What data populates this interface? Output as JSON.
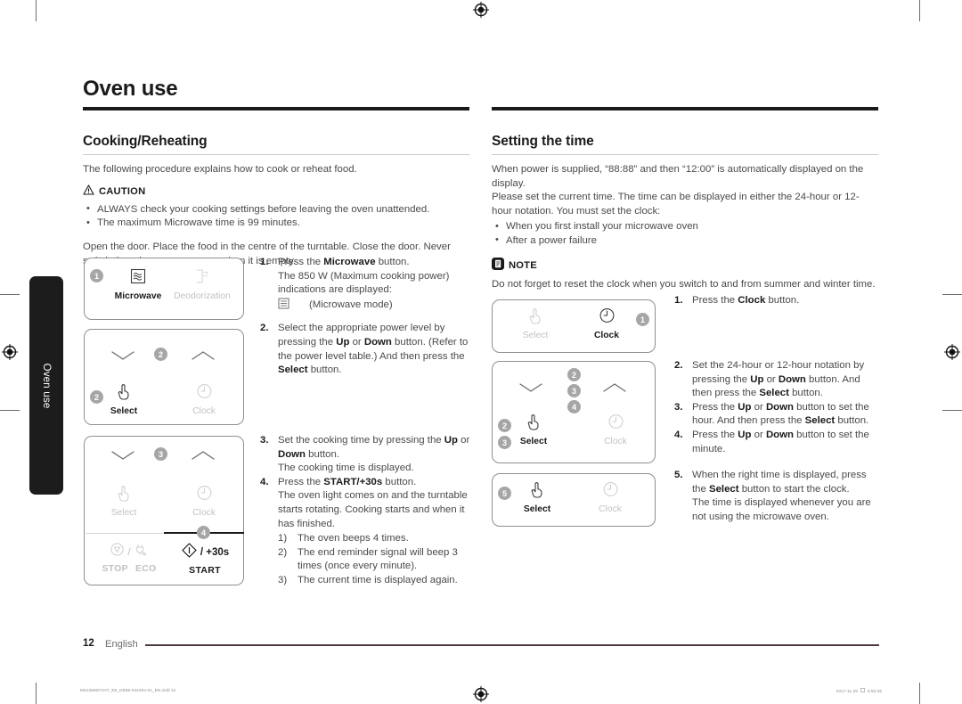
{
  "document": {
    "chapter_title": "Oven use",
    "side_tab_label": "Oven use"
  },
  "left_column": {
    "section_heading": "Cooking/Reheating",
    "intro": "The following procedure explains how to cook or reheat food.",
    "caution": {
      "icon": "warning-triangle-icon",
      "label": "CAUTION",
      "items": [
        "ALWAYS check your cooking settings before leaving the oven unattended.",
        "The maximum Microwave time is 99 minutes."
      ]
    },
    "paragraph": "Open the door. Place the food in the centre of the turntable. Close the door. Never switch the microwave oven on when it is empty.",
    "steps": [
      {
        "num": "1.",
        "lines": [
          "Press the <b>Microwave</b> button.",
          "The 850 W (Maximum cooking power) indications are displayed:"
        ],
        "icon_line": "(Microwave mode)"
      },
      {
        "num": "2.",
        "lines": [
          "Select the appropriate power level by pressing the <b>Up</b> or <b>Down</b> button. (Refer to the power level table.) And then press the <b>Select</b> button."
        ]
      },
      {
        "num": "3.",
        "lines": [
          "Set the cooking time by pressing the <b>Up</b> or <b>Down</b> button.",
          "The cooking time is displayed."
        ]
      },
      {
        "num": "4.",
        "lines": [
          "Press the <b>START/+30s</b> button.",
          "The oven light comes on and the turntable starts rotating. Cooking starts and when it has finished."
        ],
        "sub_items": [
          {
            "num": "1)",
            "text": "The oven beeps 4 times."
          },
          {
            "num": "2)",
            "text": "The end reminder signal will beep 3 times (once every minute)."
          },
          {
            "num": "3)",
            "text": "The current time is displayed again."
          }
        ]
      }
    ],
    "panels": [
      {
        "name": "microwave-panel",
        "badges": [
          {
            "label": "1"
          }
        ],
        "keys": [
          {
            "name": "microwave",
            "label": "Microwave",
            "icon": "microwave-waves-icon",
            "state": "on"
          },
          {
            "name": "deodorization",
            "label": "Deodorization",
            "icon": "deodorization-icon",
            "state": "off"
          }
        ]
      },
      {
        "name": "select-panel",
        "badges": [
          {
            "label": "2"
          },
          {
            "label": "2"
          }
        ],
        "keys": [
          {
            "name": "down",
            "label": "",
            "icon": "chevron-down-icon",
            "state": "on"
          },
          {
            "name": "up",
            "label": "",
            "icon": "chevron-up-icon",
            "state": "on"
          },
          {
            "name": "select",
            "label": "Select",
            "icon": "hand-pointer-icon",
            "state": "on"
          },
          {
            "name": "clock",
            "label": "Clock",
            "icon": "clock-icon",
            "state": "off"
          }
        ]
      },
      {
        "name": "start-panel",
        "badges": [
          {
            "label": "3"
          },
          {
            "label": "4"
          }
        ],
        "keys": [
          {
            "name": "down",
            "label": "",
            "icon": "chevron-down-icon",
            "state": "on"
          },
          {
            "name": "up",
            "label": "",
            "icon": "chevron-up-icon",
            "state": "on"
          },
          {
            "name": "select",
            "label": "Select",
            "icon": "hand-pointer-icon",
            "state": "off"
          },
          {
            "name": "clock",
            "label": "Clock",
            "icon": "clock-icon",
            "state": "off"
          },
          {
            "name": "stop",
            "label": "STOP",
            "icon": "stop-icon",
            "state": "off"
          },
          {
            "name": "eco",
            "label": "ECO",
            "icon": "eco-plug-icon",
            "state": "off"
          },
          {
            "name": "start",
            "label": "START",
            "icon": "start-diamond-icon",
            "state": "on",
            "suffix": "/ +30s"
          }
        ]
      }
    ]
  },
  "right_column": {
    "section_heading": "Setting the time",
    "paragraphs": [
      "When power is supplied, “88:88” and then “12:00” is automatically displayed on the display.",
      "Please set the current time. The time can be displayed in either the 24-hour or 12-hour notation. You must set the clock:"
    ],
    "bullets": [
      "When you first install your microwave oven",
      "After a power failure"
    ],
    "note": {
      "icon": "note-document-icon",
      "label": "NOTE",
      "text": "Do not forget to reset the clock when you switch to and from summer and winter time."
    },
    "steps": [
      {
        "num": "1.",
        "lines": [
          "Press the <b>Clock</b> button."
        ]
      },
      {
        "num": "2.",
        "lines": [
          "Set the 24-hour or 12-hour notation by pressing the <b>Up</b> or <b>Down</b> button. And then press the <b>Select</b> button."
        ]
      },
      {
        "num": "3.",
        "lines": [
          "Press the <b>Up</b> or <b>Down</b> button to set the hour. And then press the <b>Select</b> button."
        ]
      },
      {
        "num": "4.",
        "lines": [
          "Press the <b>Up</b> or <b>Down</b> button to set the minute."
        ]
      },
      {
        "num": "5.",
        "lines": [
          "When the right time is displayed, press the <b>Select</b> button to start the clock.",
          "The time is displayed whenever you are not using the microwave oven."
        ]
      }
    ],
    "panels": [
      {
        "name": "clock-panel",
        "badges": [
          {
            "label": "1"
          }
        ],
        "keys": [
          {
            "name": "select",
            "label": "Select",
            "icon": "hand-pointer-icon",
            "state": "off"
          },
          {
            "name": "clock",
            "label": "Clock",
            "icon": "clock-icon",
            "state": "on"
          }
        ]
      },
      {
        "name": "updown-select-panel",
        "badges": [
          {
            "label": "2"
          },
          {
            "label": "3"
          },
          {
            "label": "4"
          },
          {
            "label": "2"
          },
          {
            "label": "3"
          }
        ],
        "keys": [
          {
            "name": "down",
            "label": "",
            "icon": "chevron-down-icon",
            "state": "on"
          },
          {
            "name": "up",
            "label": "",
            "icon": "chevron-up-icon",
            "state": "on"
          },
          {
            "name": "select",
            "label": "Select",
            "icon": "hand-pointer-icon",
            "state": "on"
          },
          {
            "name": "clock",
            "label": "Clock",
            "icon": "clock-icon",
            "state": "off"
          }
        ]
      },
      {
        "name": "select-confirm-panel",
        "badges": [
          {
            "label": "5"
          }
        ],
        "keys": [
          {
            "name": "select",
            "label": "Select",
            "icon": "hand-pointer-icon",
            "state": "on"
          },
          {
            "name": "clock",
            "label": "Clock",
            "icon": "clock-icon",
            "state": "off"
          }
        ]
      }
    ]
  },
  "footer": {
    "page_number": "12",
    "language": "English",
    "imprint_left": "MS23M8074AT_EE_DE68-04445V-01_EN.indd   12",
    "imprint_date": "2017-11-29",
    "imprint_time": "6:50:35"
  }
}
